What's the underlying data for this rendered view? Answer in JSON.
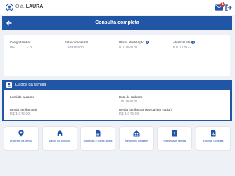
{
  "topbar": {
    "greeting": "Olá,",
    "user_name": "LAURA",
    "notification_count": "1"
  },
  "header": {
    "title": "Consulta completa"
  },
  "summary": {
    "codigo_label": "Código familiar",
    "codigo_value_part1": "06-",
    "codigo_value_part2": "- 8",
    "estado_label": "Estado cadastral",
    "estado_value": "Cadastrado",
    "ultima_label": "Última atualização",
    "ultima_value": "07/10/2020",
    "atualizar_label": "Atualizar até",
    "atualizar_value": "07/10/2022"
  },
  "family": {
    "section_title": "Dados da família",
    "local_label": "Local do cadastro",
    "local_value": "",
    "data_label": "Data do cadastro",
    "data_value": "10/10/2020",
    "renda_total_label": "Renda familiar total",
    "renda_total_value": "R$ 1.046,00",
    "renda_pessoa_label": "Renda familiar por pessoa (per capita)",
    "renda_pessoa_value": "R$ 1.046,00"
  },
  "actions": [
    {
      "label": "Endereço da família",
      "icon": "location-pin-icon"
    },
    {
      "label": "Dados do domicílio",
      "icon": "house-icon"
    },
    {
      "label": "Despesas e outros dados",
      "icon": "document-icon"
    },
    {
      "label": "Integrantes familiares",
      "icon": "family-house-icon"
    },
    {
      "label": "Responsável familiar",
      "icon": "id-badge-icon"
    },
    {
      "label": "Exportar Consulta",
      "icon": "export-icon"
    }
  ],
  "colors": {
    "primary": "#2155a6",
    "background": "#eef1f6",
    "badge": "#d32f2f"
  }
}
